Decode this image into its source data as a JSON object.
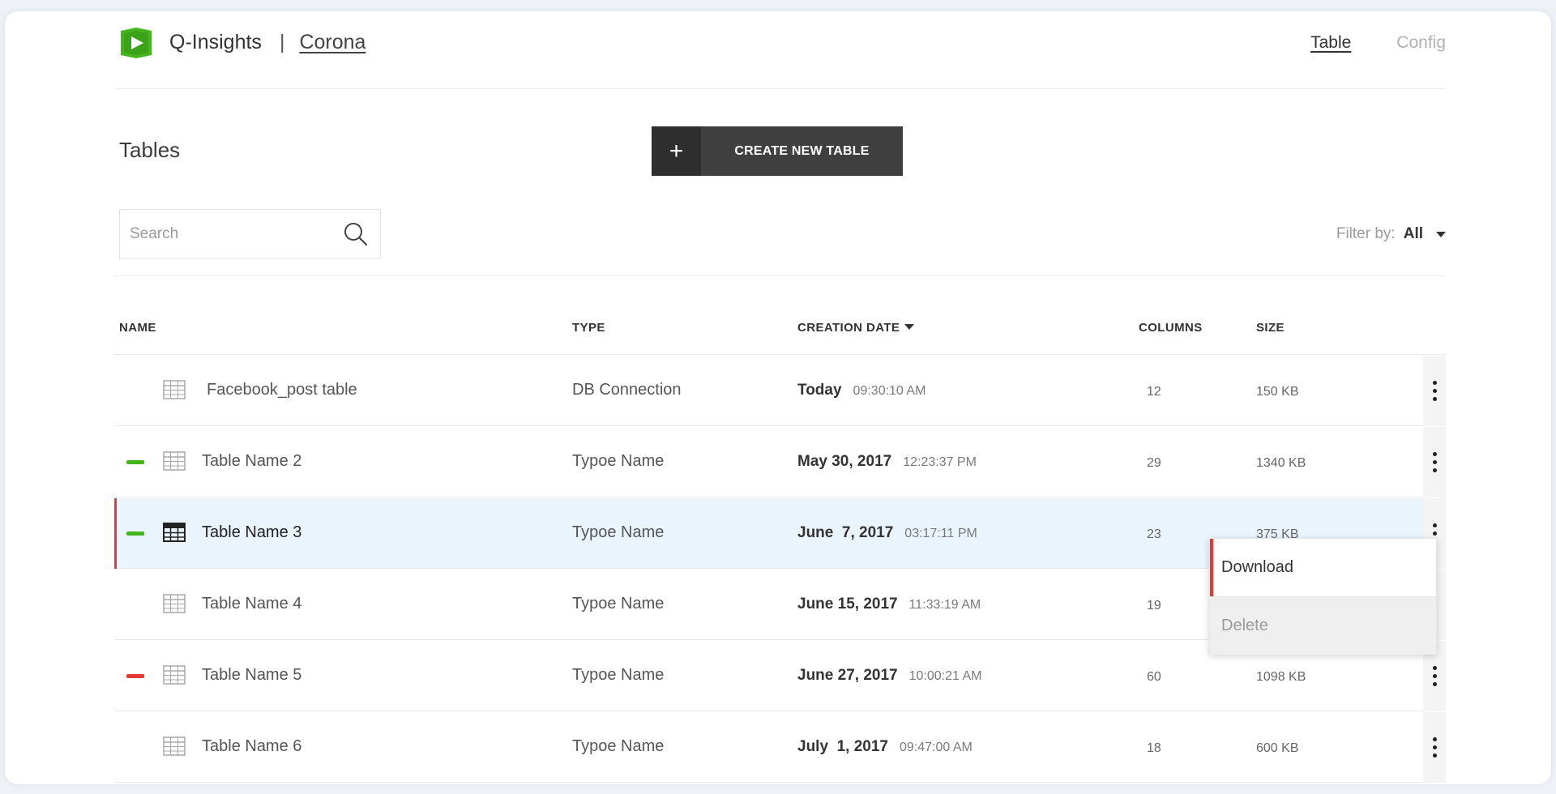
{
  "app": {
    "name": "Q-Insights",
    "separator": "|",
    "project": "Corona",
    "accent_color": "#44b51e"
  },
  "nav": {
    "table_label": "Table",
    "config_label": "Config"
  },
  "toolbar": {
    "title": "Tables",
    "create_icon": "+",
    "create_label": "CREATE NEW TABLE"
  },
  "search": {
    "placeholder": "Search",
    "icon": "search-icon"
  },
  "filter": {
    "label": "Filter by:",
    "value": "All"
  },
  "table": {
    "headers": {
      "name": "NAME",
      "type": "TYPE",
      "creation_date": "CREATION DATE",
      "columns": "COLUMNS",
      "size": "SIZE"
    },
    "sorted_by": "creation_date",
    "rows": [
      {
        "name": "Facebook_post table",
        "type": "DB Connection",
        "date": "Today",
        "time": "09:30:10 AM",
        "columns": "12",
        "size": "150 KB",
        "status": "none",
        "selected": false
      },
      {
        "name": "Table Name 2",
        "type": "Typoe Name",
        "date": "May 30, 2017",
        "time": "12:23:37 PM",
        "columns": "29",
        "size": "1340 KB",
        "status": "green",
        "selected": false
      },
      {
        "name": "Table Name 3",
        "type": "Typoe Name",
        "date": "June  7, 2017",
        "time": "03:17:11 PM",
        "columns": "23",
        "size": "375 KB",
        "status": "green",
        "selected": true
      },
      {
        "name": "Table Name 4",
        "type": "Typoe Name",
        "date": "June 15, 2017",
        "time": "11:33:19 AM",
        "columns": "19",
        "size": "",
        "status": "none",
        "selected": false
      },
      {
        "name": "Table Name 5",
        "type": "Typoe Name",
        "date": "June 27, 2017",
        "time": "10:00:21 AM",
        "columns": "60",
        "size": "1098 KB",
        "status": "red",
        "selected": false
      },
      {
        "name": "Table Name 6",
        "type": "Typoe Name",
        "date": "July  1, 2017",
        "time": "09:47:00 AM",
        "columns": "18",
        "size": "600 KB",
        "status": "none",
        "selected": false
      }
    ]
  },
  "context_menu": {
    "download_label": "Download",
    "delete_label": "Delete"
  },
  "colors": {
    "status_green": "#44b51e",
    "status_red": "#e53935",
    "selected_row_bg": "#e9f4fd",
    "button_bg": "#3f3f3f"
  }
}
